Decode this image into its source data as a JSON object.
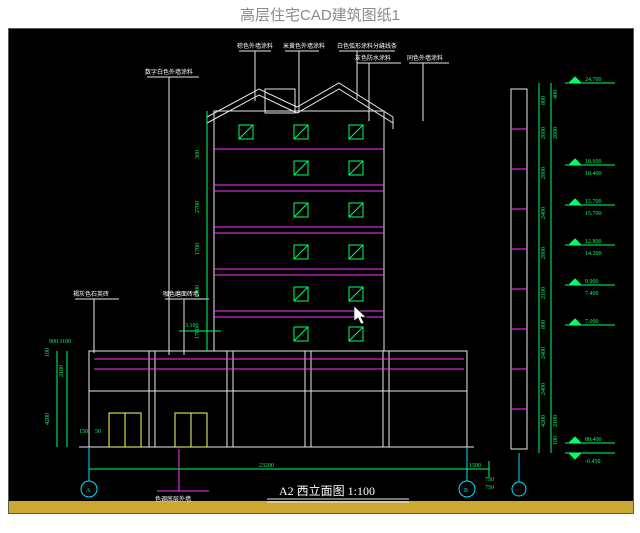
{
  "title": "高层住宅CAD建筑图纸1",
  "drawing_title": "A2 西立面图  1:100",
  "labels": {
    "l1": "棕色外墙涂料",
    "l2": "米黄色外墙涂料",
    "l3": "白色弧形涂料分缝线条",
    "l4": "灰色防水涂料",
    "l5": "数字白色外墙涂料",
    "l6": "同色外墙涂料",
    "l7": "褐灰色石英砖",
    "l8": "咖色磨面砖墙",
    "l9": "色调底层外墙"
  },
  "axis": {
    "A": "A",
    "B": "B"
  },
  "dims": {
    "total_width": "23200",
    "right_ext": "1500",
    "d750_1": "750",
    "d750_2": "750",
    "h150": "150",
    "h50": "50",
    "h4200": "4200",
    "h2100": "2100",
    "h100": "100",
    "h900_1100": "900 1100",
    "g3100": "3.100",
    "floor": {
      "f1": "1700",
      "f2": "2700",
      "f3": "1700",
      "f4": "2700",
      "f5": "300"
    },
    "right_elev": {
      "e1": "24.700",
      "e2": "18.600",
      "e3": "15.700",
      "e4": "12.800",
      "e5": "9.900",
      "e6": "7.000"
    },
    "right_cum": {
      "c1": "18.400",
      "c2": "15.700",
      "c3": "14.200",
      "c4": "7.400"
    },
    "right_seg": {
      "s1": "800",
      "s2": "2600",
      "s3": "2800",
      "s4": "2400",
      "s5": "2800",
      "s6": "2100",
      "s7": "800",
      "s8": "2400",
      "s9": "2400",
      "s10": "4200",
      "s11": "2100",
      "s12": "2600",
      "s13": "400",
      "s14": "100",
      "s15": "80.400",
      "s16": "-0.450"
    }
  }
}
